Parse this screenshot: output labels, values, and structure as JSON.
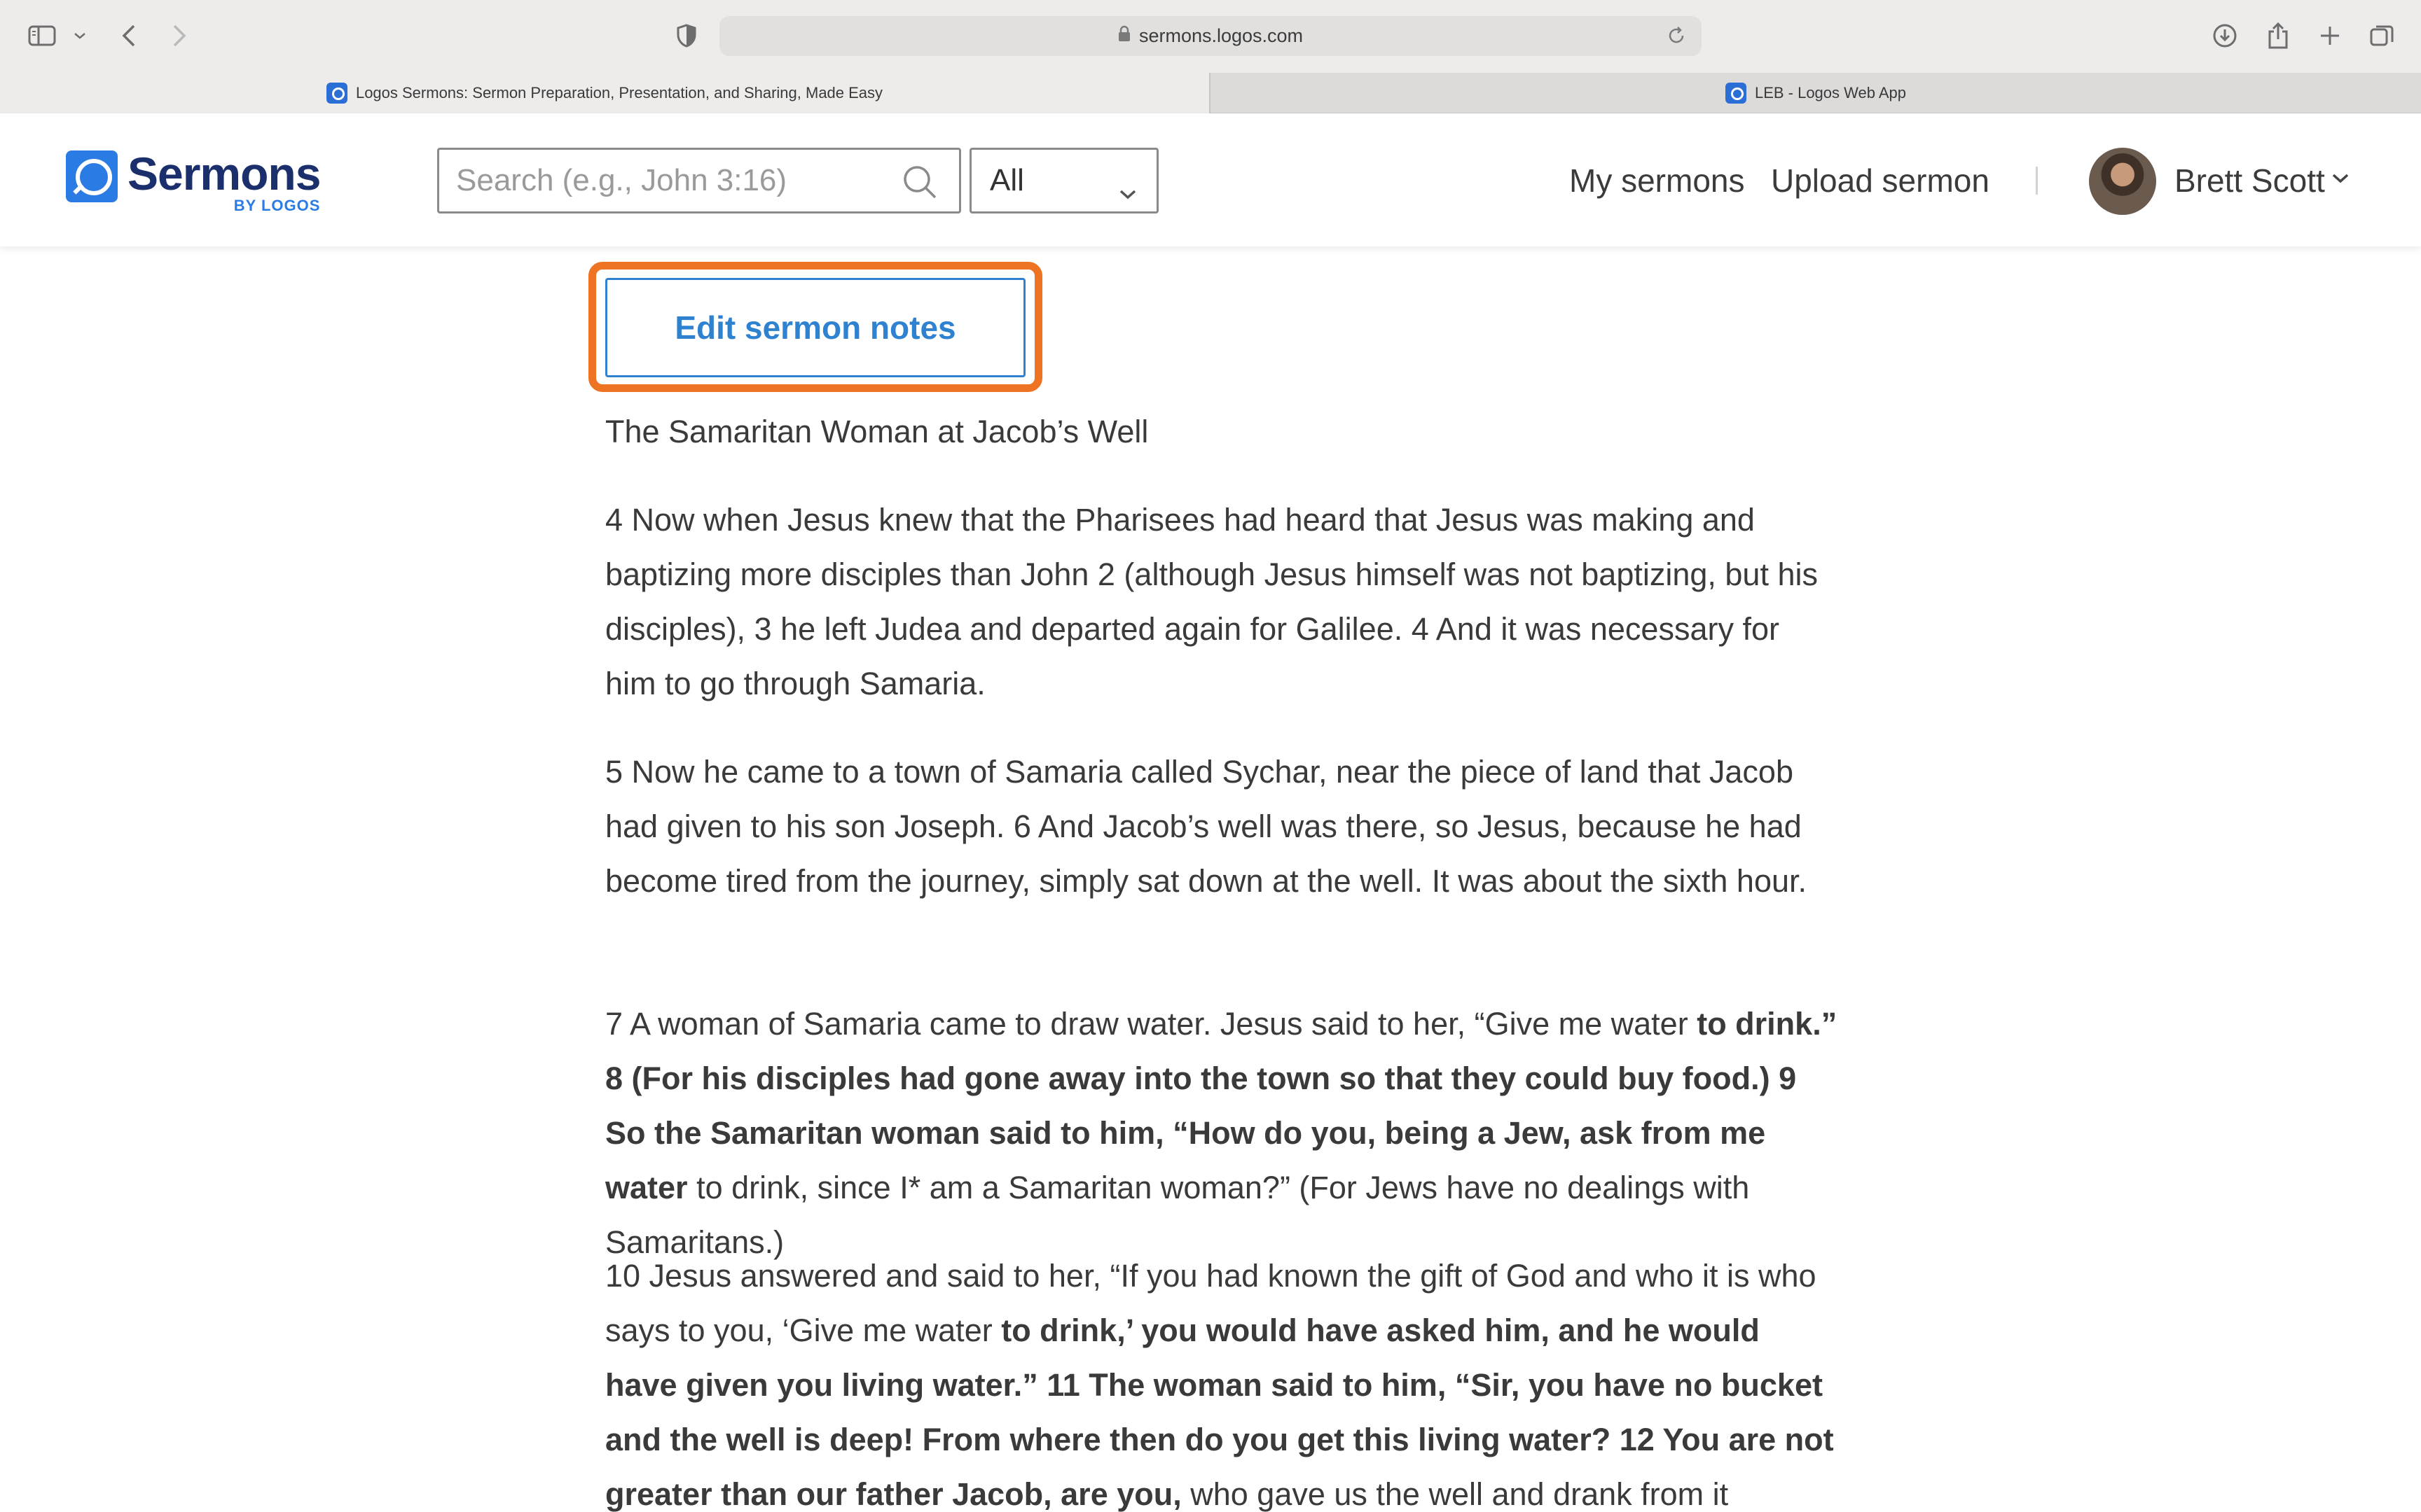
{
  "browser": {
    "url": "sermons.logos.com",
    "tabs": [
      {
        "label": "Logos Sermons: Sermon Preparation, Presentation, and Sharing, Made Easy",
        "active": true
      },
      {
        "label": "LEB - Logos Web App",
        "active": false
      }
    ]
  },
  "header": {
    "logo_word": "Sermons",
    "logo_by": "BY LOGOS",
    "search_placeholder": "Search (e.g., John 3:16)",
    "filter_value": "All",
    "nav": {
      "my_sermons": "My sermons",
      "upload_sermon": "Upload sermon"
    },
    "user_name": "Brett Scott"
  },
  "main": {
    "edit_button": "Edit sermon notes",
    "heading": "The Samaritan Woman at Jacob’s Well",
    "paragraphs": [
      [
        {
          "t": "4 Now when Jesus knew that the Pharisees had heard that Jesus was making and baptizing more disciples than John 2 (although Jesus himself was not baptizing, but his disciples), 3 he left Judea and departed again for Galilee. 4 And it was necessary for him to go through Samaria.",
          "b": false
        }
      ],
      [
        {
          "t": "5 Now he came to a town of Samaria called Sychar, near the piece of land that Jacob had given to his son Joseph. 6 And Jacob’s well was there, so Jesus, because he had become tired from the journey, simply sat down at the well. It was about the sixth hour.",
          "b": false
        }
      ],
      [
        {
          "t": "7 A woman of Samaria came to draw water. Jesus said to her, “Give me water ",
          "b": false
        },
        {
          "t": "to drink.” 8 (For his disciples had gone away into the town so that they could buy food.) 9 So the Samaritan woman said to him, “How do you, being a Jew, ask from me water",
          "b": true
        },
        {
          "t": " to drink, since I* am a Samaritan woman?” (For Jews have no dealings with Samaritans.)",
          "b": false
        }
      ],
      [
        {
          "t": "10 Jesus answered and said to her, “If you had known the gift of God and who it is who says to you, ‘Give me water ",
          "b": false
        },
        {
          "t": "to drink,’ you would have asked him, and he would have given you living water.” 11 The woman said to him, “Sir, you have no bucket and the well is deep! From where then do you get this living water? 12 You are not greater than our father Jacob, are you,",
          "b": true
        },
        {
          "t": " who gave us the well and drank from it himself, and",
          "b": false
        }
      ]
    ]
  }
}
